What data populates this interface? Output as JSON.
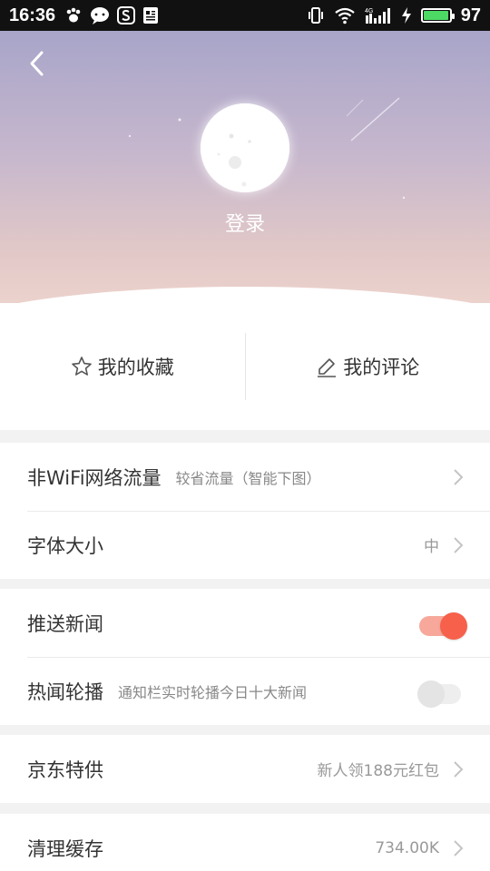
{
  "status_bar": {
    "time": "16:36",
    "battery_level": "97",
    "battery_fraction": 0.97,
    "network": "4G",
    "left_icons": [
      "baidu-paw-icon",
      "chat-bubble-icon",
      "s-app-icon",
      "news-doc-icon"
    ],
    "right_icons": [
      "vibrate-icon",
      "wifi-icon",
      "signal-icon",
      "charging-icon",
      "battery-icon"
    ]
  },
  "header": {
    "back_icon": "back-chevron-icon",
    "login_label": "登录",
    "gradient_top": "#a8a5c9",
    "gradient_bottom": "#ecd2cc"
  },
  "quick_actions": [
    {
      "label": "我的收藏",
      "icon": "star-icon"
    },
    {
      "label": "我的评论",
      "icon": "pencil-icon"
    }
  ],
  "settings": {
    "data_traffic": {
      "label": "非WiFi网络流量",
      "desc": "较省流量（智能下图）"
    },
    "font_size": {
      "label": "字体大小",
      "value": "中"
    },
    "push_news": {
      "label": "推送新闻",
      "enabled": true
    },
    "hot_news": {
      "label": "热闻轮播",
      "desc": "通知栏实时轮播今日十大新闻",
      "enabled": false
    },
    "jd_offer": {
      "label": "京东特供",
      "value": "新人领188元红包"
    },
    "clear_cache": {
      "label": "清理缓存",
      "value": "734.00K"
    }
  },
  "colors": {
    "accent": "#f7604a",
    "accent_track": "#f8a89b",
    "background": "#f2f2f2"
  }
}
